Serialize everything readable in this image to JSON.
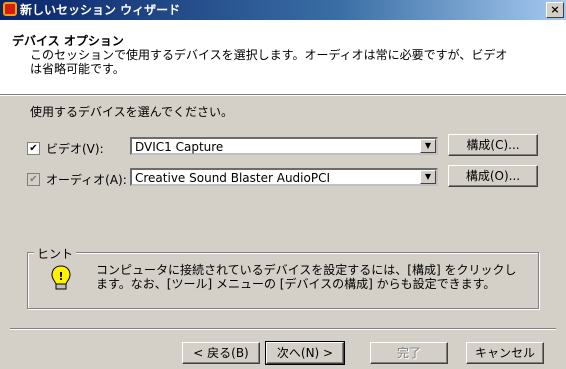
{
  "window": {
    "title": "新しいセッション ウィザード",
    "close_glyph": "×"
  },
  "header": {
    "title": "デバイス オプション",
    "description": "このセッションで使用するデバイスを選択します。オーディオは常に必要ですが、ビデオは省略可能です。"
  },
  "instruction": "使用するデバイスを選んでください。",
  "devices": {
    "video": {
      "label": "ビデオ(V):",
      "checked": true,
      "value": "DVIC1 Capture",
      "configure": "構成(C)..."
    },
    "audio": {
      "label": "オーディオ(A):",
      "checked": true,
      "disabled": true,
      "value": "Creative Sound Blaster AudioPCI",
      "configure": "構成(O)..."
    }
  },
  "hint": {
    "legend": "ヒント",
    "text": "コンピュータに接続されているデバイスを設定するには、[構成] をクリックします。なお、[ツール] メニューの [デバイスの構成] からも設定できます。"
  },
  "footer": {
    "back": "< 戻る(B)",
    "next": "次へ(N) >",
    "finish": "完了",
    "cancel": "キャンセル"
  },
  "colors": {
    "title_gradient_start": "#0a246a",
    "title_gradient_end": "#a6caf0",
    "face": "#d4d0c8"
  }
}
